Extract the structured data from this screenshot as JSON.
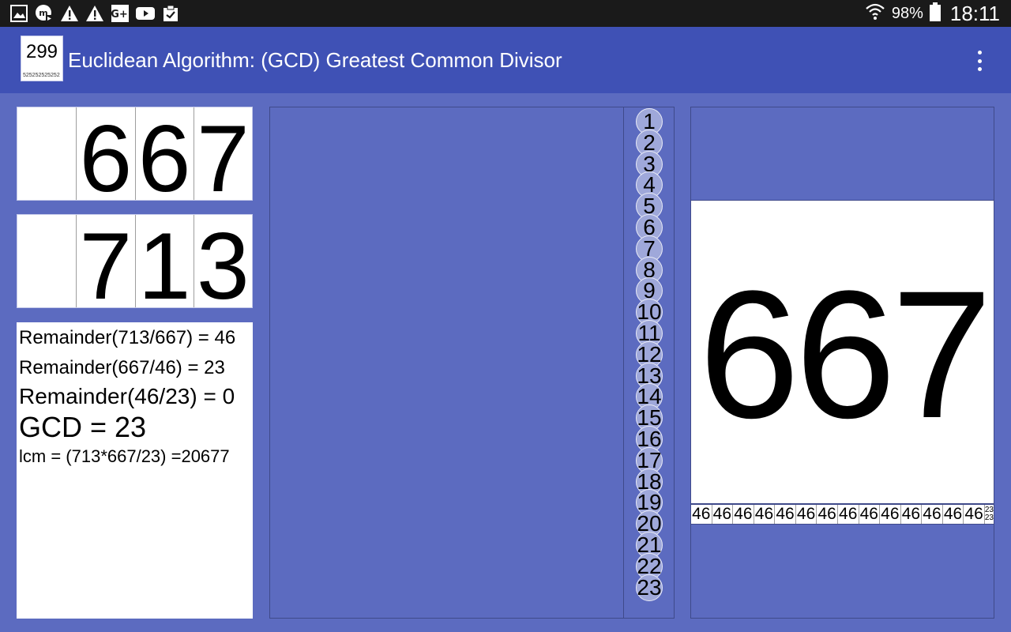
{
  "status_bar": {
    "icons": [
      "gallery-icon",
      "app-notification-icon",
      "warning-icon",
      "warning-icon",
      "google-plus-icon",
      "youtube-icon",
      "clipboard-icon"
    ],
    "battery_percent": "98%",
    "time": "18:11"
  },
  "app_bar": {
    "logo_number": "299",
    "logo_sub": "525252525252",
    "title": "Euclidean Algorithm: (GCD) Greatest Common Divisor"
  },
  "inputs": {
    "first_digits": [
      "",
      "6",
      "6",
      "7"
    ],
    "second_digits": [
      "",
      "7",
      "1",
      "3"
    ]
  },
  "results": {
    "line1": "Remainder(713/667) = 46",
    "line2": "Remainder(667/46) = 23",
    "line3": "Remainder(46/23) = 0",
    "gcd": "GCD = 23",
    "lcm": "lcm = (713*667/23) =20677"
  },
  "steps": [
    "1",
    "2",
    "3",
    "4",
    "5",
    "6",
    "7",
    "8",
    "9",
    "10",
    "11",
    "12",
    "13",
    "14",
    "15",
    "16",
    "17",
    "18",
    "19",
    "20",
    "21",
    "22",
    "23"
  ],
  "display": {
    "big_number": "667",
    "strip_value": "46",
    "strip_count": 14,
    "strip_end_top": "23",
    "strip_end_bottom": "23"
  }
}
